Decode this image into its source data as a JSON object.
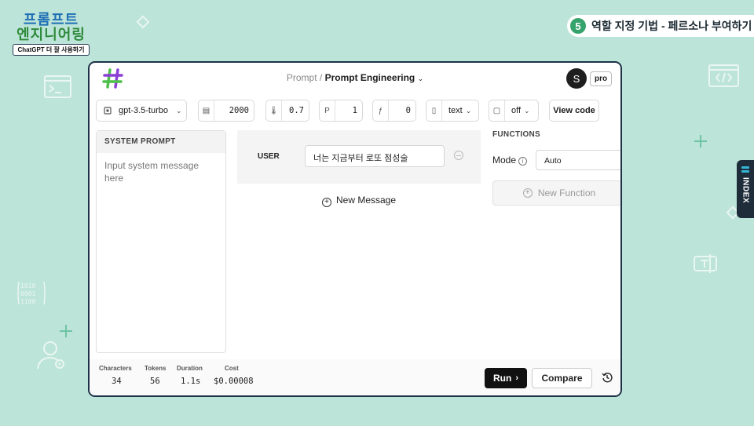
{
  "logo": {
    "line1": "프롬프트",
    "line2": "엔지니어링",
    "tagline": "ChatGPT 더 잘 사용하기"
  },
  "chapter": {
    "number": "5",
    "title": "역할 지정 기법 - 페르소나 부여하기"
  },
  "index_tab": {
    "label": "INDEX"
  },
  "app": {
    "breadcrumb_parent": "Prompt /",
    "breadcrumb_current": "Prompt Engineering",
    "avatar_letter": "S",
    "plan_badge": "pro"
  },
  "toolbar": {
    "model": "gpt-3.5-turbo",
    "max_tokens": "2000",
    "temperature": "0.7",
    "top_p": "1",
    "frequency_penalty": "0",
    "response_format": "text",
    "json_mode": "off",
    "view_code": "View code"
  },
  "system_prompt": {
    "header": "SYSTEM PROMPT",
    "placeholder": "Input system message here"
  },
  "messages": [
    {
      "role": "USER",
      "content": "너는 지금부터 로또 점성술"
    }
  ],
  "new_message_label": "New Message",
  "functions": {
    "header": "FUNCTIONS",
    "mode_label": "Mode",
    "mode_value": "Auto",
    "new_function_label": "New Function"
  },
  "stats": {
    "characters_label": "Characters",
    "characters": "34",
    "tokens_label": "Tokens",
    "tokens": "56",
    "duration_label": "Duration",
    "duration": "1.1s",
    "cost_label": "Cost",
    "cost": "$0.00008"
  },
  "actions": {
    "run": "Run",
    "compare": "Compare"
  },
  "colors": {
    "background": "#bde4d8",
    "window_border": "#1d3147",
    "hash_green": "#4dbf4a",
    "hash_purple": "#8b3fd6",
    "chapter_badge": "#35a36b"
  }
}
